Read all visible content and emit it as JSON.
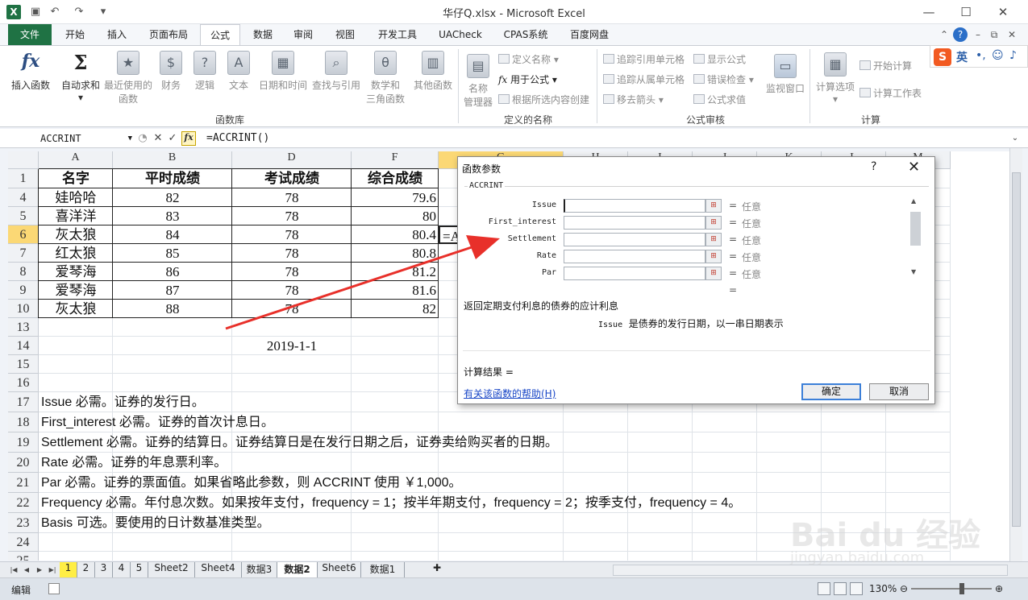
{
  "window": {
    "title": "华仔Q.xlsx - Microsoft Excel",
    "app_icon": "X",
    "controls": {
      "minimize": "—",
      "maximize": "☐",
      "close": "✕"
    }
  },
  "ribbon_tabs": [
    "文件",
    "开始",
    "插入",
    "页面布局",
    "公式",
    "数据",
    "审阅",
    "视图",
    "开发工具",
    "UACheck",
    "CPAS系统",
    "百度网盘"
  ],
  "active_tab": "公式",
  "ribbon": {
    "library": {
      "insert_fn": "插入函数",
      "autosum": "自动求和",
      "recent": [
        "最近使用的",
        "函数"
      ],
      "finance": "财务",
      "logic": "逻辑",
      "text": "文本",
      "datetime": "日期和时间",
      "lookup": "查找与引用",
      "math": [
        "数学和",
        "三角函数"
      ],
      "other": "其他函数",
      "group": "函数库"
    },
    "names": {
      "manager": [
        "名称",
        "管理器"
      ],
      "define": "定义名称",
      "use_in": "用于公式",
      "create": "根据所选内容创建",
      "group": "定义的名称"
    },
    "audit": {
      "trace_prec": "追踪引用单元格",
      "trace_dep": "追踪从属单元格",
      "remove": "移去箭头",
      "show": "显示公式",
      "check": "错误检查",
      "eval": "公式求值",
      "watch": "监视窗口",
      "group": "公式审核"
    },
    "calc": {
      "options": "计算选项",
      "now": "开始计算",
      "sheet": "计算工作表",
      "group": "计算"
    }
  },
  "ime": {
    "logo": "S",
    "mode": "英"
  },
  "formula_bar": {
    "name_box": "ACCRINT",
    "formula": "=ACCRINT()",
    "cancel": "✕",
    "enter": "✓",
    "fx": "fx"
  },
  "columns": [
    "A",
    "B",
    "D",
    "F",
    "G",
    "H",
    "I",
    "J",
    "K",
    "L",
    "M"
  ],
  "selected_column": "G",
  "rows": [
    "1",
    "4",
    "5",
    "6",
    "7",
    "8",
    "9",
    "10",
    "13",
    "14",
    "15",
    "16",
    "17",
    "18",
    "19",
    "20",
    "21",
    "22",
    "23",
    "24",
    "25"
  ],
  "selected_row": "6",
  "table": {
    "headers": [
      "名字",
      "平时成绩",
      "考试成绩",
      "综合成绩"
    ],
    "rows": [
      [
        "娃哈哈",
        "82",
        "78",
        "79.6"
      ],
      [
        "喜洋洋",
        "83",
        "78",
        "80"
      ],
      [
        "灰太狼",
        "84",
        "78",
        "80.4"
      ],
      [
        "红太狼",
        "85",
        "78",
        "80.8"
      ],
      [
        "爱琴海",
        "86",
        "78",
        "81.2"
      ],
      [
        "爱琴海",
        "87",
        "78",
        "81.6"
      ],
      [
        "灰太狼",
        "88",
        "78",
        "82"
      ]
    ],
    "editing_cell": "=ACCRINT("
  },
  "date_cell": "2019-1-1",
  "notes": [
    "Issue 必需。证券的发行日。",
    "First_interest 必需。证券的首次计息日。",
    "Settlement 必需。证券的结算日。证券结算日是在发行日期之后，证券卖给购买者的日期。",
    "Rate 必需。证券的年息票利率。",
    "Par 必需。证券的票面值。如果省略此参数，则 ACCRINT 使用 ￥1,000。",
    "Frequency 必需。年付息次数。如果按年支付，frequency = 1；按半年期支付，frequency = 2；按季支付，frequency = 4。",
    "Basis 可选。要使用的日计数基准类型。"
  ],
  "dialog": {
    "title": "函数参数",
    "help_mark": "?",
    "close": "✕",
    "function_name": "ACCRINT",
    "args": [
      {
        "label": "Issue",
        "value": "",
        "result": "任意"
      },
      {
        "label": "First_interest",
        "value": "",
        "result": "任意"
      },
      {
        "label": "Settlement",
        "value": "",
        "result": "任意"
      },
      {
        "label": "Rate",
        "value": "",
        "result": "任意"
      },
      {
        "label": "Par",
        "value": "",
        "result": "任意"
      }
    ],
    "equals": "=",
    "description": "返回定期支付利息的债券的应计利息",
    "arg_name": "Issue",
    "arg_description": "是债券的发行日期，以一串日期表示",
    "calc_result_label": "计算结果 =",
    "help_link": "有关该函数的帮助(H)",
    "ok": "确定",
    "cancel": "取消"
  },
  "sheet_tabs": [
    "1",
    "2",
    "3",
    "4",
    "5",
    "Sheet2",
    "Sheet4",
    "数据3",
    "数据2",
    "Sheet6",
    "数据1"
  ],
  "active_sheet": "数据2",
  "status": {
    "mode": "编辑",
    "zoom": "130%"
  },
  "watermark": {
    "brand": "Bai du 经验",
    "url": "jingyan.baidu.com"
  },
  "colors": {
    "excel_green": "#1f7244",
    "selection_yellow": "#fbd875",
    "arrow_red": "#e8302a",
    "link_blue": "#1a47c7"
  }
}
